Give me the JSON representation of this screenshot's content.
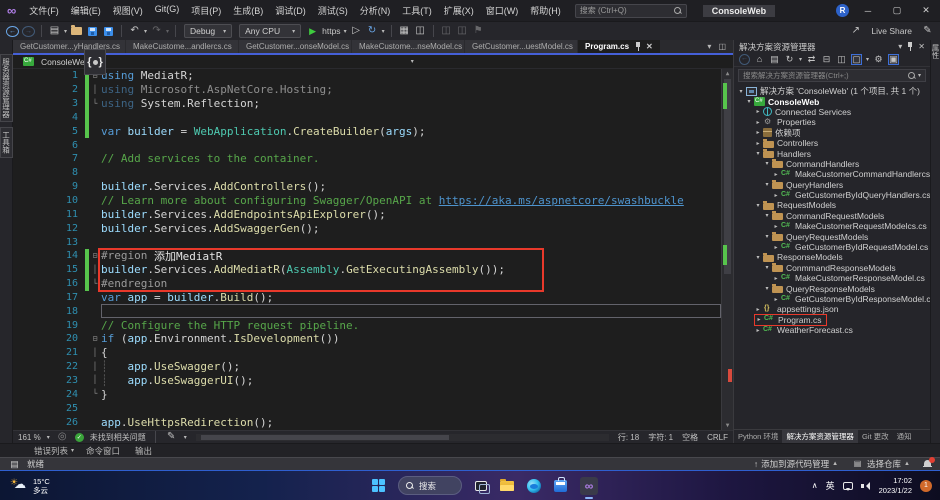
{
  "window": {
    "title": "ConsoleWeb",
    "search_placeholder": "搜索 (Ctrl+Q)",
    "avatar": "R",
    "minimize": "─",
    "maximize": "▢",
    "close": "✕"
  },
  "menus": [
    "文件(F)",
    "编辑(E)",
    "视图(V)",
    "Git(G)",
    "项目(P)",
    "生成(B)",
    "调试(D)",
    "测试(S)",
    "分析(N)",
    "工具(T)",
    "扩展(X)",
    "窗口(W)",
    "帮助(H)"
  ],
  "toolbar": {
    "debug": "Debug",
    "cpu": "Any CPU",
    "run_profile": "https",
    "live_share": "Live Share"
  },
  "left_tabs": [
    {
      "label": "服务器资源管理器"
    },
    {
      "label": "工具箱"
    }
  ],
  "right_strip_label": "属性",
  "tabs": [
    {
      "label": "GetCustomer...yHandlers.cs",
      "active": "false"
    },
    {
      "label": "MakeCustome...andlercs.cs",
      "active": "false"
    },
    {
      "label": "GetCustomer...onseModel.cs",
      "active": "false"
    },
    {
      "label": "MakeCustome...nseModel.cs",
      "active": "false"
    },
    {
      "label": "GetCustomer...uestModel.cs",
      "active": "false"
    },
    {
      "label": "Program.cs",
      "active": "true"
    }
  ],
  "breadcrumb": {
    "project": "ConsoleWeb"
  },
  "editor": {
    "lines": [
      {
        "n": "1",
        "fold": "⊟",
        "flags": "changed",
        "segs": [
          {
            "t": "using ",
            "c": "kw"
          },
          {
            "t": "MediatR",
            "c": "id"
          },
          {
            "t": ";",
            "c": "pun"
          }
        ]
      },
      {
        "n": "2",
        "fold": "│",
        "flags": "changed",
        "segs": [
          {
            "t": "using ",
            "c": "kwdim"
          },
          {
            "t": "Microsoft.AspNetCore.Hosting",
            "c": "iddim"
          },
          {
            "t": ";",
            "c": "iddim"
          }
        ]
      },
      {
        "n": "3",
        "fold": "└",
        "flags": "changed",
        "segs": [
          {
            "t": "using ",
            "c": "kwdim"
          },
          {
            "t": "System.Reflection",
            "c": "id"
          },
          {
            "t": ";",
            "c": "pun"
          }
        ]
      },
      {
        "n": "4",
        "flags": "changed",
        "segs": []
      },
      {
        "n": "5",
        "flags": "changed",
        "segs": [
          {
            "t": "var ",
            "c": "kw"
          },
          {
            "t": "builder",
            "c": "var"
          },
          {
            "t": " = ",
            "c": "pun"
          },
          {
            "t": "WebApplication",
            "c": "type"
          },
          {
            "t": ".",
            "c": "pun"
          },
          {
            "t": "CreateBuilder",
            "c": "meth"
          },
          {
            "t": "(",
            "c": "pun"
          },
          {
            "t": "args",
            "c": "var"
          },
          {
            "t": ");",
            "c": "pun"
          }
        ]
      },
      {
        "n": "6",
        "segs": []
      },
      {
        "n": "7",
        "segs": [
          {
            "t": "// Add services to the container.",
            "c": "com"
          }
        ]
      },
      {
        "n": "8",
        "segs": []
      },
      {
        "n": "9",
        "segs": [
          {
            "t": "builder",
            "c": "var"
          },
          {
            "t": ".",
            "c": "pun"
          },
          {
            "t": "Services",
            "c": "id"
          },
          {
            "t": ".",
            "c": "pun"
          },
          {
            "t": "AddControllers",
            "c": "meth"
          },
          {
            "t": "();",
            "c": "pun"
          }
        ]
      },
      {
        "n": "10",
        "segs": [
          {
            "t": "// Learn more about configuring Swagger/OpenAPI at ",
            "c": "com"
          },
          {
            "t": "https://aka.ms/aspnetcore/swashbuckle",
            "c": "url"
          }
        ]
      },
      {
        "n": "11",
        "segs": [
          {
            "t": "builder",
            "c": "var"
          },
          {
            "t": ".",
            "c": "pun"
          },
          {
            "t": "Services",
            "c": "id"
          },
          {
            "t": ".",
            "c": "pun"
          },
          {
            "t": "AddEndpointsApiExplorer",
            "c": "meth"
          },
          {
            "t": "();",
            "c": "pun"
          }
        ]
      },
      {
        "n": "12",
        "segs": [
          {
            "t": "builder",
            "c": "var"
          },
          {
            "t": ".",
            "c": "pun"
          },
          {
            "t": "Services",
            "c": "id"
          },
          {
            "t": ".",
            "c": "pun"
          },
          {
            "t": "AddSwaggerGen",
            "c": "meth"
          },
          {
            "t": "();",
            "c": "pun"
          }
        ]
      },
      {
        "n": "13",
        "segs": []
      },
      {
        "n": "14",
        "fold": "⊟",
        "flags": "changed",
        "segs": [
          {
            "t": "#region",
            "c": "pre"
          },
          {
            "t": " 添加MediatR",
            "c": "regname"
          }
        ]
      },
      {
        "n": "15",
        "fold": "│",
        "flags": "changed",
        "segs": [
          {
            "t": "builder",
            "c": "var"
          },
          {
            "t": ".",
            "c": "pun"
          },
          {
            "t": "Services",
            "c": "id"
          },
          {
            "t": ".",
            "c": "pun"
          },
          {
            "t": "AddMediatR",
            "c": "meth"
          },
          {
            "t": "(",
            "c": "pun"
          },
          {
            "t": "Assembly",
            "c": "type"
          },
          {
            "t": ".",
            "c": "pun"
          },
          {
            "t": "GetExecutingAssembly",
            "c": "meth"
          },
          {
            "t": "());",
            "c": "pun"
          }
        ]
      },
      {
        "n": "16",
        "fold": "└",
        "flags": "changed",
        "segs": [
          {
            "t": "#endregion",
            "c": "pre"
          }
        ]
      },
      {
        "n": "17",
        "segs": [
          {
            "t": "var ",
            "c": "kw"
          },
          {
            "t": "app",
            "c": "var"
          },
          {
            "t": " = ",
            "c": "pun"
          },
          {
            "t": "builder",
            "c": "var"
          },
          {
            "t": ".",
            "c": "pun"
          },
          {
            "t": "Build",
            "c": "meth"
          },
          {
            "t": "();",
            "c": "pun"
          }
        ]
      },
      {
        "n": "18",
        "flags": "current",
        "segs": []
      },
      {
        "n": "19",
        "segs": [
          {
            "t": "// Configure the HTTP request pipeline.",
            "c": "com"
          }
        ]
      },
      {
        "n": "20",
        "fold": "⊟",
        "segs": [
          {
            "t": "if ",
            "c": "kw"
          },
          {
            "t": "(",
            "c": "pun"
          },
          {
            "t": "app",
            "c": "var"
          },
          {
            "t": ".",
            "c": "pun"
          },
          {
            "t": "Environment",
            "c": "id"
          },
          {
            "t": ".",
            "c": "pun"
          },
          {
            "t": "IsDevelopment",
            "c": "meth"
          },
          {
            "t": "())",
            "c": "pun"
          }
        ]
      },
      {
        "n": "21",
        "fold": "│",
        "segs": [
          {
            "t": "{",
            "c": "pun"
          }
        ]
      },
      {
        "n": "22",
        "fold": "│",
        "segs": [
          {
            "t": "┊   ",
            "c": "guide"
          },
          {
            "t": "app",
            "c": "var"
          },
          {
            "t": ".",
            "c": "pun"
          },
          {
            "t": "UseSwagger",
            "c": "meth"
          },
          {
            "t": "();",
            "c": "pun"
          }
        ]
      },
      {
        "n": "23",
        "fold": "│",
        "segs": [
          {
            "t": "┊   ",
            "c": "guide"
          },
          {
            "t": "app",
            "c": "var"
          },
          {
            "t": ".",
            "c": "pun"
          },
          {
            "t": "UseSwaggerUI",
            "c": "meth"
          },
          {
            "t": "();",
            "c": "pun"
          }
        ]
      },
      {
        "n": "24",
        "fold": "└",
        "segs": [
          {
            "t": "}",
            "c": "pun"
          }
        ]
      },
      {
        "n": "25",
        "segs": []
      },
      {
        "n": "26",
        "segs": [
          {
            "t": "app",
            "c": "var"
          },
          {
            "t": ".",
            "c": "pun"
          },
          {
            "t": "UseHttpsRedirection",
            "c": "meth"
          },
          {
            "t": "();",
            "c": "pun"
          }
        ]
      }
    ],
    "status": {
      "zoom": "161 %",
      "issues": "未找到相关问题",
      "ln": "行: 18",
      "col": "字符: 1",
      "spaces": "空格",
      "eol": "CRLF"
    }
  },
  "solution_explorer": {
    "title": "解决方案资源管理器",
    "search_placeholder": "搜索解决方案资源管理器(Ctrl+;)",
    "tree": [
      {
        "level": "0",
        "arrow": "▾",
        "icon": "sln",
        "label": "解决方案 'ConsoleWeb' (1 个项目, 共 1 个)"
      },
      {
        "level": "1",
        "arrow": "▾",
        "icon": "proj",
        "label": "ConsoleWeb",
        "bold": "true"
      },
      {
        "level": "2",
        "arrow": "▸",
        "icon": "svc",
        "label": "Connected Services"
      },
      {
        "level": "2",
        "arrow": "▸",
        "icon": "props",
        "label": "Properties"
      },
      {
        "level": "2",
        "arrow": "▸",
        "icon": "deps",
        "label": "依赖项"
      },
      {
        "level": "2",
        "arrow": "▸",
        "icon": "folder",
        "label": "Controllers"
      },
      {
        "level": "2",
        "arrow": "▾",
        "icon": "folder",
        "label": "Handlers"
      },
      {
        "level": "3",
        "arrow": "▾",
        "icon": "folder",
        "label": "CommandHandlers"
      },
      {
        "level": "4",
        "arrow": "▸",
        "icon": "cs",
        "label": "MakeCustomerCommandHandlercs.cs"
      },
      {
        "level": "3",
        "arrow": "▾",
        "icon": "folder",
        "label": "QueryHandlers"
      },
      {
        "level": "4",
        "arrow": "▸",
        "icon": "cs",
        "label": "GetCustomerByIdQueryHandlers.cs"
      },
      {
        "level": "2",
        "arrow": "▾",
        "icon": "folder",
        "label": "RequestModels"
      },
      {
        "level": "3",
        "arrow": "▾",
        "icon": "folder",
        "label": "CommandRequestModels"
      },
      {
        "level": "4",
        "arrow": "▸",
        "icon": "cs",
        "label": "MakeCustomerRequestModelcs.cs"
      },
      {
        "level": "3",
        "arrow": "▾",
        "icon": "folder",
        "label": "QueryRequestModels"
      },
      {
        "level": "4",
        "arrow": "▸",
        "icon": "cs",
        "label": "GetCustomerByIdRequestModel.cs"
      },
      {
        "level": "2",
        "arrow": "▾",
        "icon": "folder",
        "label": "ResponseModels"
      },
      {
        "level": "3",
        "arrow": "▾",
        "icon": "folder",
        "label": "ConmmandResponseModels"
      },
      {
        "level": "4",
        "arrow": "▸",
        "icon": "cs",
        "label": "MakeCustomerResponseModel.cs"
      },
      {
        "level": "3",
        "arrow": "▾",
        "icon": "folder",
        "label": "QueryResponseModels"
      },
      {
        "level": "4",
        "arrow": "▸",
        "icon": "cs",
        "label": "GetCustomerByIdResponseModel.cs"
      },
      {
        "level": "2",
        "arrow": "▸",
        "icon": "json",
        "label": "appsettings.json"
      },
      {
        "level": "2",
        "arrow": "▸",
        "icon": "cs",
        "label": "Program.cs",
        "boxed": "true"
      },
      {
        "level": "2",
        "arrow": "▸",
        "icon": "cs",
        "label": "WeatherForecast.cs"
      }
    ],
    "bottom_tabs": [
      {
        "label": "Python 环境",
        "active": "false"
      },
      {
        "label": "解决方案资源管理器",
        "active": "true"
      },
      {
        "label": "Git 更改",
        "active": "false"
      },
      {
        "label": "通知",
        "active": "false"
      }
    ]
  },
  "bottom_panel": {
    "tabs": [
      {
        "label": "错误列表",
        "caret": "▾"
      },
      {
        "label": "命令窗口"
      },
      {
        "label": "输出"
      }
    ]
  },
  "status_bar": {
    "ready": "就绪",
    "add_source_control": "添加到源代码管理",
    "select_repo": "选择仓库"
  },
  "taskbar": {
    "weather_temp": "15°C",
    "weather_desc": "多云",
    "search_label": "搜索",
    "ime": "英",
    "time": "17:02",
    "date": "2023/1/22",
    "badge": "1"
  }
}
